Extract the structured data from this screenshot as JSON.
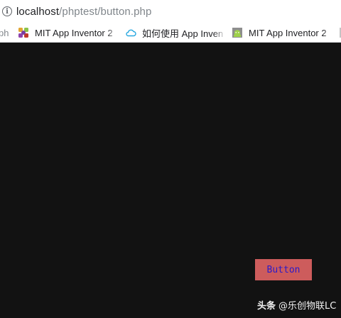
{
  "address_bar": {
    "host": "localhost",
    "path": "/phptest/button.php"
  },
  "bookmarks": {
    "fragment_label": "ph",
    "items": [
      {
        "label": "MIT App Inventor 2",
        "icon": "mit-app-inventor-icon"
      },
      {
        "label": "如何使用 App Inventor",
        "icon": "cloud-icon"
      },
      {
        "label": "MIT App Inventor 2",
        "icon": "android-robot-icon"
      }
    ]
  },
  "page": {
    "background_color": "#121212",
    "button_label": "Button",
    "button_color": "#cd5c5c"
  },
  "watermark": {
    "brand": "头条",
    "handle": "@乐创物联LC"
  }
}
